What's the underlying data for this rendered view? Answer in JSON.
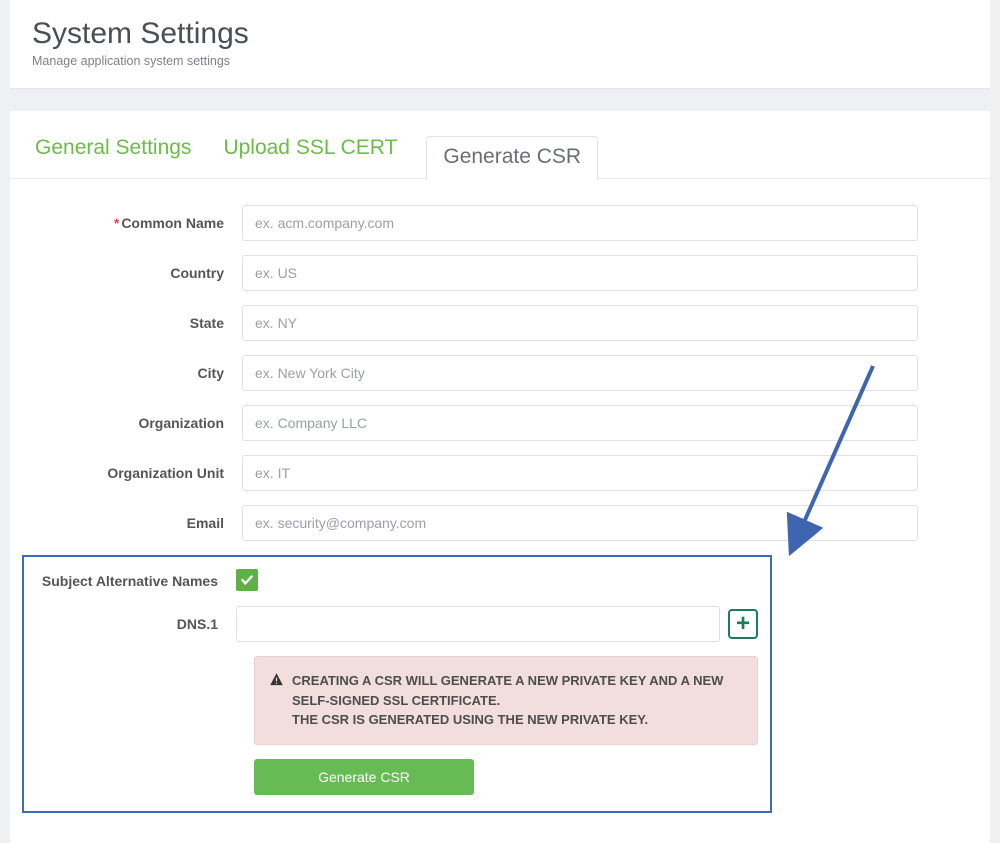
{
  "header": {
    "title": "System Settings",
    "subtitle": "Manage application system settings"
  },
  "tabs": {
    "general": "General Settings",
    "upload": "Upload SSL CERT",
    "generate": "Generate CSR"
  },
  "form": {
    "common_name_label": "Common Name",
    "common_name_placeholder": "ex. acm.company.com",
    "country_label": "Country",
    "country_placeholder": "ex. US",
    "state_label": "State",
    "state_placeholder": "ex. NY",
    "city_label": "City",
    "city_placeholder": "ex. New York City",
    "organization_label": "Organization",
    "organization_placeholder": "ex. Company LLC",
    "org_unit_label": "Organization Unit",
    "org_unit_placeholder": "ex. IT",
    "email_label": "Email",
    "email_placeholder": "ex. security@company.com"
  },
  "san": {
    "label": "Subject Alternative Names",
    "dns1_label": "DNS.1",
    "add_icon": "+"
  },
  "warning": {
    "line1": "CREATING A CSR WILL GENERATE A NEW PRIVATE KEY AND A NEW SELF-SIGNED SSL CERTIFICATE.",
    "line2": "THE CSR IS GENERATED USING THE NEW PRIVATE KEY."
  },
  "button": {
    "generate": "Generate CSR"
  },
  "colors": {
    "accent_green": "#66bb55",
    "tab_green": "#6dbb4a",
    "highlight_blue": "#3d6db8",
    "warning_bg": "#f3dede",
    "danger_red": "#d64a4a"
  }
}
